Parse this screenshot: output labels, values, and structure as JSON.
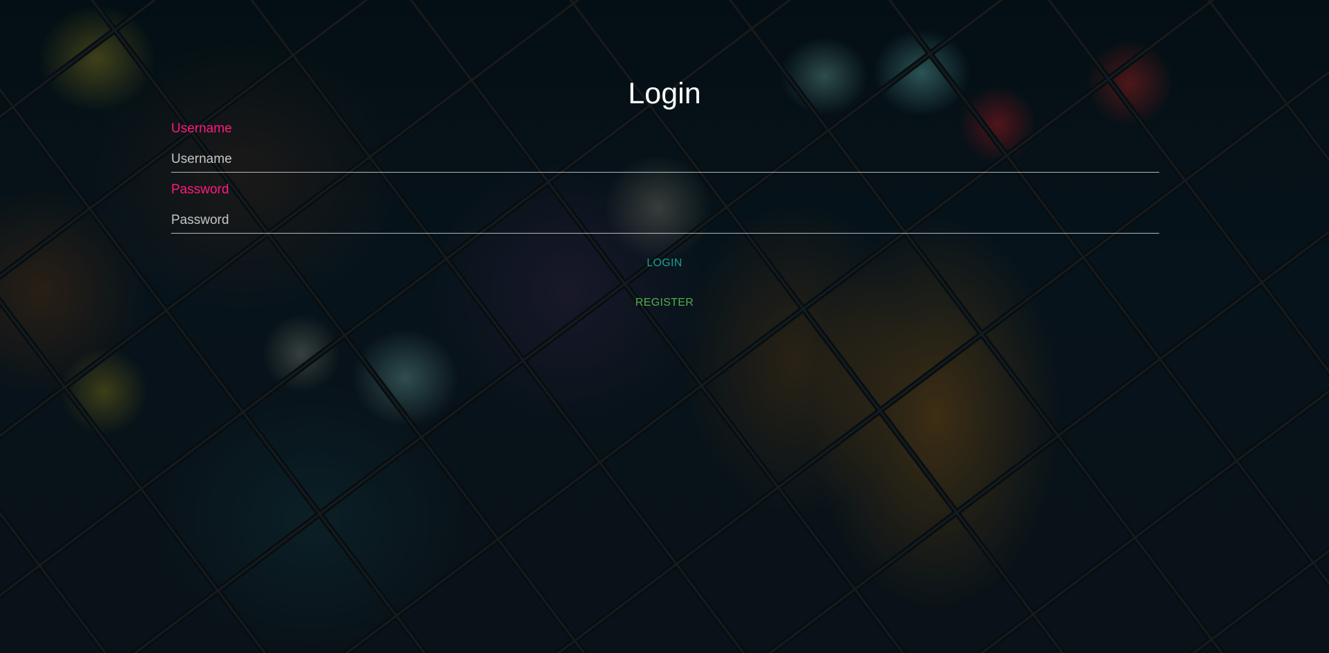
{
  "page": {
    "title": "Login"
  },
  "form": {
    "username": {
      "label": "Username",
      "placeholder": "Username",
      "value": ""
    },
    "password": {
      "label": "Password",
      "placeholder": "Password",
      "value": ""
    },
    "login_label": "LOGIN",
    "register_label": "REGISTER"
  },
  "colors": {
    "label_accent": "#ff1a7f",
    "login_button": "#1b9e92",
    "register_button": "#52b04a",
    "title": "#ffffff"
  }
}
